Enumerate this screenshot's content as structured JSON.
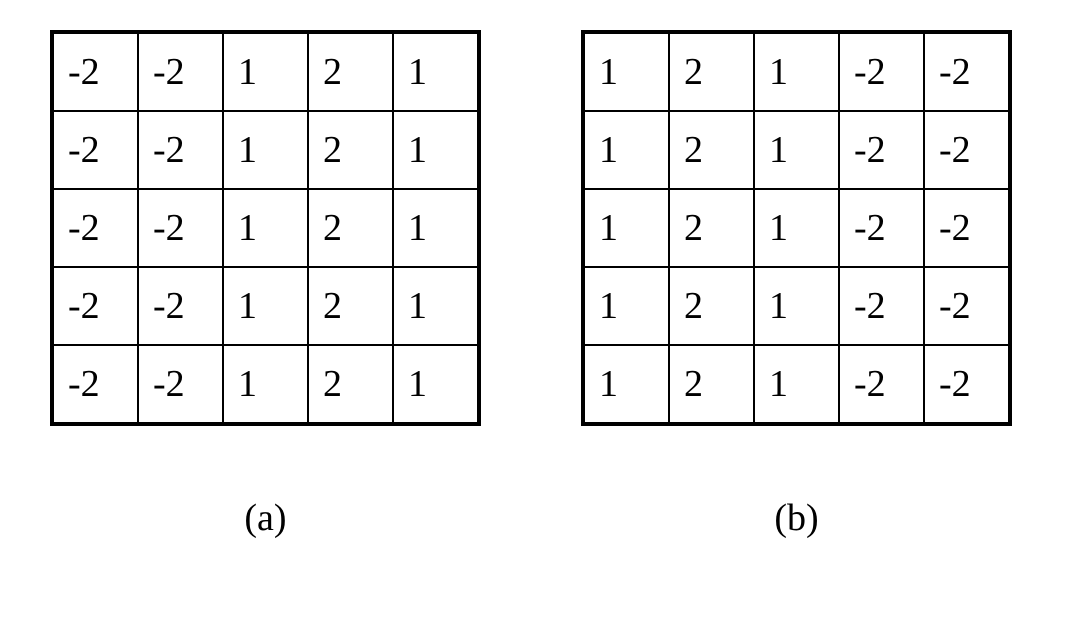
{
  "matrices": [
    {
      "caption": "(a)",
      "rows": [
        [
          "-2",
          "-2",
          "1",
          "2",
          "1"
        ],
        [
          "-2",
          "-2",
          "1",
          "2",
          "1"
        ],
        [
          "-2",
          "-2",
          "1",
          "2",
          "1"
        ],
        [
          "-2",
          "-2",
          "1",
          "2",
          "1"
        ],
        [
          "-2",
          "-2",
          "1",
          "2",
          "1"
        ]
      ]
    },
    {
      "caption": "(b)",
      "rows": [
        [
          "1",
          "2",
          "1",
          "-2",
          "-2"
        ],
        [
          "1",
          "2",
          "1",
          "-2",
          "-2"
        ],
        [
          "1",
          "2",
          "1",
          "-2",
          "-2"
        ],
        [
          "1",
          "2",
          "1",
          "-2",
          "-2"
        ],
        [
          "1",
          "2",
          "1",
          "-2",
          "-2"
        ]
      ]
    }
  ]
}
